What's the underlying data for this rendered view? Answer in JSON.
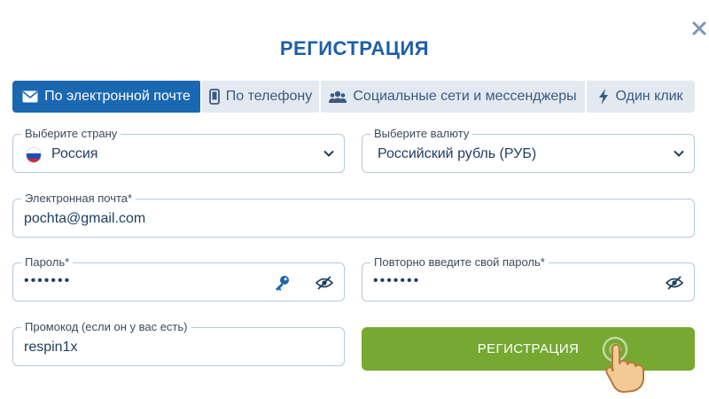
{
  "modal": {
    "title": "РЕГИСТРАЦИЯ",
    "close_icon": "close-icon"
  },
  "tabs": [
    {
      "label": "По электронной почте",
      "icon": "envelope-icon",
      "active": true
    },
    {
      "label": "По телефону",
      "icon": "phone-icon",
      "active": false
    },
    {
      "label": "Социальные сети и мессенджеры",
      "icon": "users-icon",
      "active": false
    },
    {
      "label": "Один клик",
      "icon": "lightning-icon",
      "active": false
    }
  ],
  "form": {
    "country": {
      "label": "Выберите страну",
      "value": "Россия",
      "icon": "russia-flag-icon"
    },
    "currency": {
      "label": "Выберите валюту",
      "value": "Российский рубль (РУБ)"
    },
    "email": {
      "label": "Электронная почта*",
      "value": "pochta@gmail.com"
    },
    "password": {
      "label": "Пароль*",
      "value": "•••••••"
    },
    "password_repeat": {
      "label": "Повторно введите свой пароль*",
      "value": "•••••••"
    },
    "promo": {
      "label": "Промокод (если он у вас есть)",
      "value": "respin1x"
    }
  },
  "submit": {
    "label": "РЕГИСТРАЦИЯ"
  },
  "colors": {
    "brand_blue": "#1a67b2",
    "title_blue": "#1d5fa8",
    "button_green": "#76a832",
    "tab_inactive": "#e3e9f1",
    "field_border": "#b8c8da"
  }
}
